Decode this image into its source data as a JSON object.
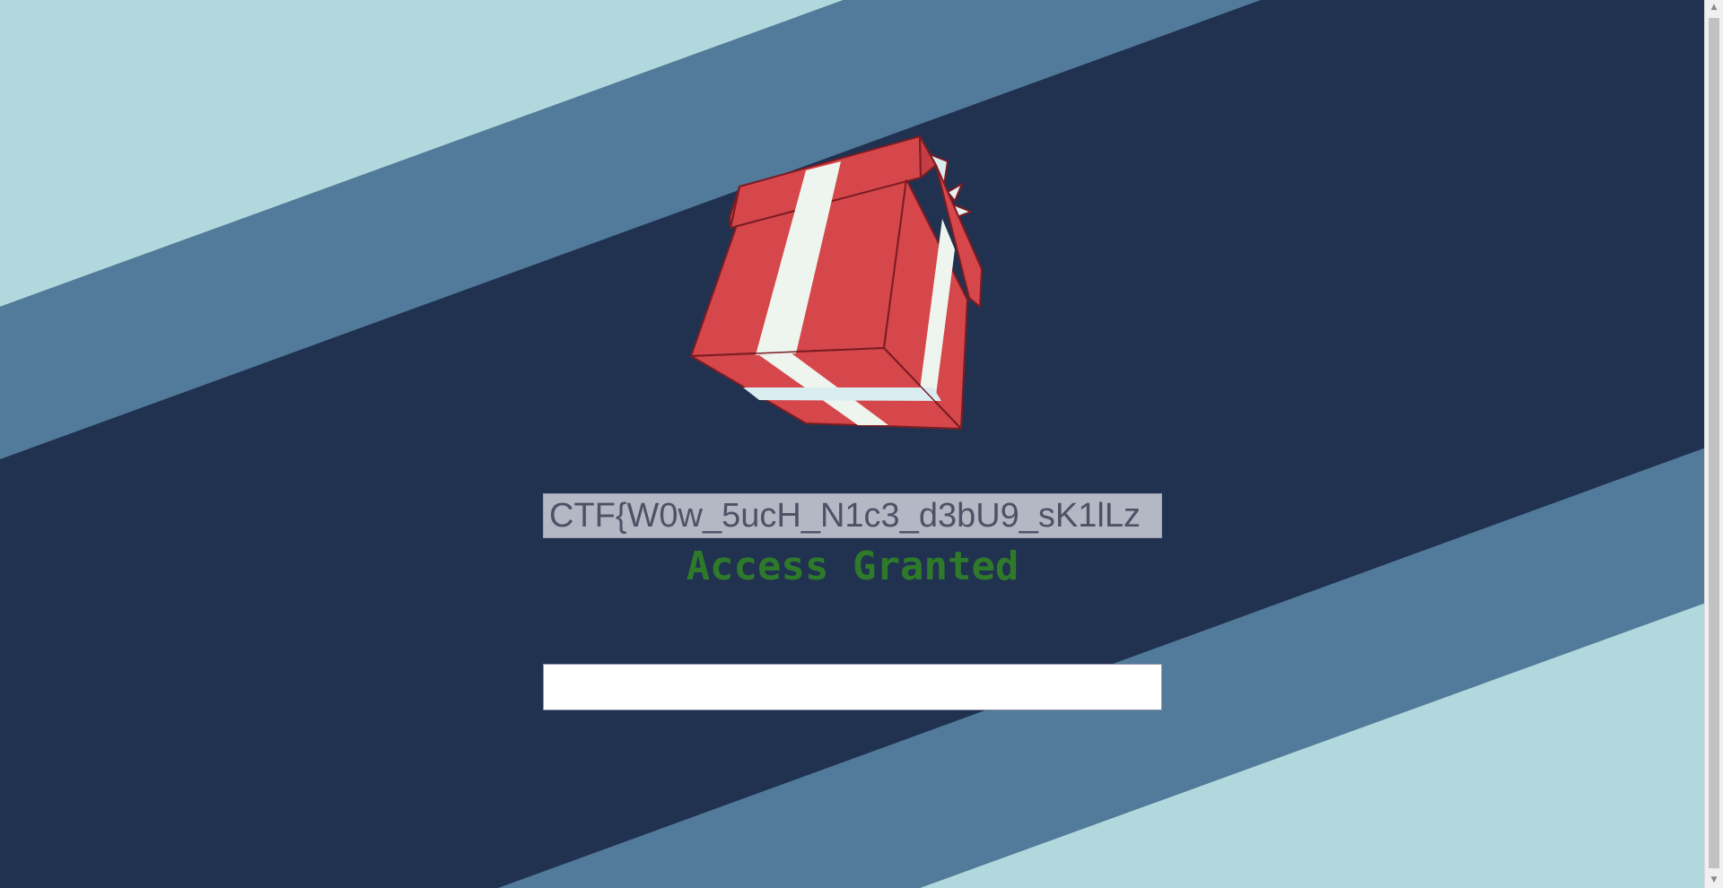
{
  "page": {
    "flag_text": "CTF{W0w_5ucH_N1c3_d3bU9_sK1lLz",
    "status_text": "Access Granted",
    "input_value": ""
  },
  "scrollbar": {
    "up_arrow": "▲",
    "down_arrow": "▼"
  },
  "colors": {
    "background_dark": "#213251",
    "band_mid": "#527a9a",
    "band_light": "#b1d8dc",
    "gift_red": "#d5474b",
    "ribbon": "#eef5ee",
    "status_green": "#2e7a2a"
  },
  "icons": {
    "gift": "gift-box-icon"
  }
}
